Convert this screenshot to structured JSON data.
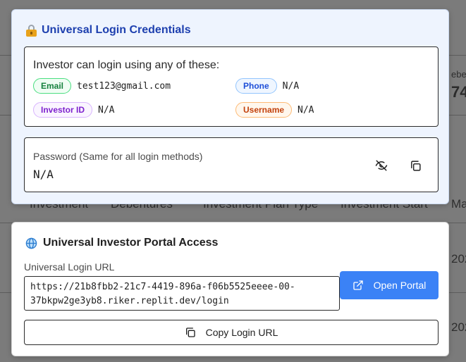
{
  "background": {
    "headers": [
      "Investment",
      "Debentures",
      "Investment Plan Type",
      "Investment Start",
      "Ma"
    ],
    "side_label": "ebe",
    "side_stat": "74",
    "row_years": [
      "202",
      "202"
    ]
  },
  "credentials": {
    "title": "Universal Login Credentials",
    "lock_icon": "lock-icon",
    "methods_heading": "Investor can login using any of these:",
    "methods": [
      {
        "label": "Email",
        "value": "test123@gmail.com"
      },
      {
        "label": "Phone",
        "value": "N/A"
      },
      {
        "label": "Investor ID",
        "value": "N/A"
      },
      {
        "label": "Username",
        "value": "N/A"
      }
    ],
    "password_label": "Password (Same for all login methods)",
    "password_value": "N/A",
    "toggle_icon": "eye-off-icon",
    "copy_icon": "copy-icon"
  },
  "portal": {
    "title": "Universal Investor Portal Access",
    "globe_icon": "globe-icon",
    "url_label": "Universal Login URL",
    "url_line1": "https://21b8fbb2-21c7-4419-896a-f06b5525eeee-00-",
    "url_line2": "37bkpw2ge3yb8.riker.replit.dev/login",
    "open_label": "Open Portal",
    "copy_url_label": "Copy Login URL",
    "accent": "#3b82f6"
  }
}
